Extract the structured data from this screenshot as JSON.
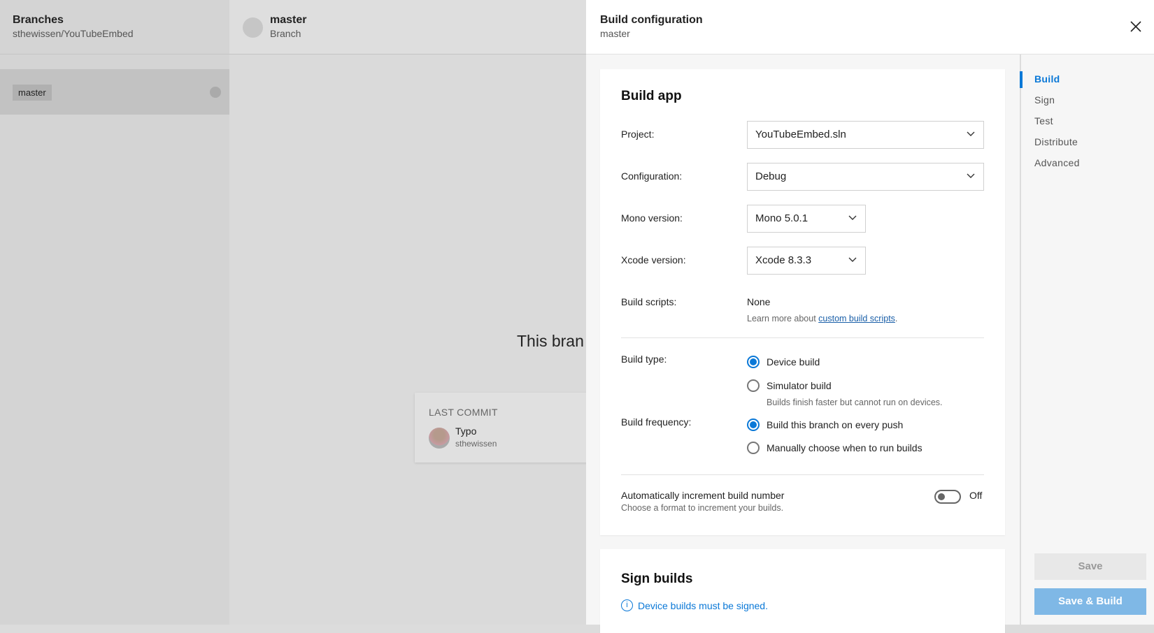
{
  "branches_panel": {
    "title": "Branches",
    "subtitle": "sthewissen/YouTubeEmbed",
    "items": [
      {
        "label": "master"
      }
    ]
  },
  "branch_panel": {
    "title": "master",
    "subtitle": "Branch",
    "empty_message": "This bran",
    "last_commit": {
      "label": "LAST COMMIT",
      "message": "Typo",
      "author": "sthewissen"
    }
  },
  "config": {
    "title": "Build configuration",
    "subtitle": "master",
    "close_icon": "close-icon",
    "build_app": {
      "heading": "Build app",
      "project": {
        "label": "Project:",
        "value": "YouTubeEmbed.sln"
      },
      "configuration": {
        "label": "Configuration:",
        "value": "Debug"
      },
      "mono": {
        "label": "Mono version:",
        "value": "Mono 5.0.1"
      },
      "xcode": {
        "label": "Xcode version:",
        "value": "Xcode 8.3.3"
      },
      "scripts": {
        "label": "Build scripts:",
        "value": "None",
        "hint_prefix": "Learn more about ",
        "hint_link": "custom build scripts",
        "hint_suffix": "."
      },
      "build_type": {
        "label": "Build type:",
        "options": [
          "Device build",
          "Simulator build"
        ],
        "selected": "Device build",
        "hint": "Builds finish faster but cannot run on devices."
      },
      "frequency": {
        "label": "Build frequency:",
        "options": [
          "Build this branch on every push",
          "Manually choose when to run builds"
        ],
        "selected": "Build this branch on every push"
      },
      "auto_increment": {
        "label": "Automatically increment build number",
        "hint": "Choose a format to increment your builds.",
        "state": "Off"
      }
    },
    "sign_builds": {
      "heading": "Sign builds",
      "info": "Device builds must be signed."
    },
    "nav": {
      "items": [
        "Build",
        "Sign",
        "Test",
        "Distribute",
        "Advanced"
      ],
      "active": "Build"
    },
    "buttons": {
      "save": "Save",
      "save_build": "Save & Build"
    },
    "accent_color": "#0a78d7"
  }
}
